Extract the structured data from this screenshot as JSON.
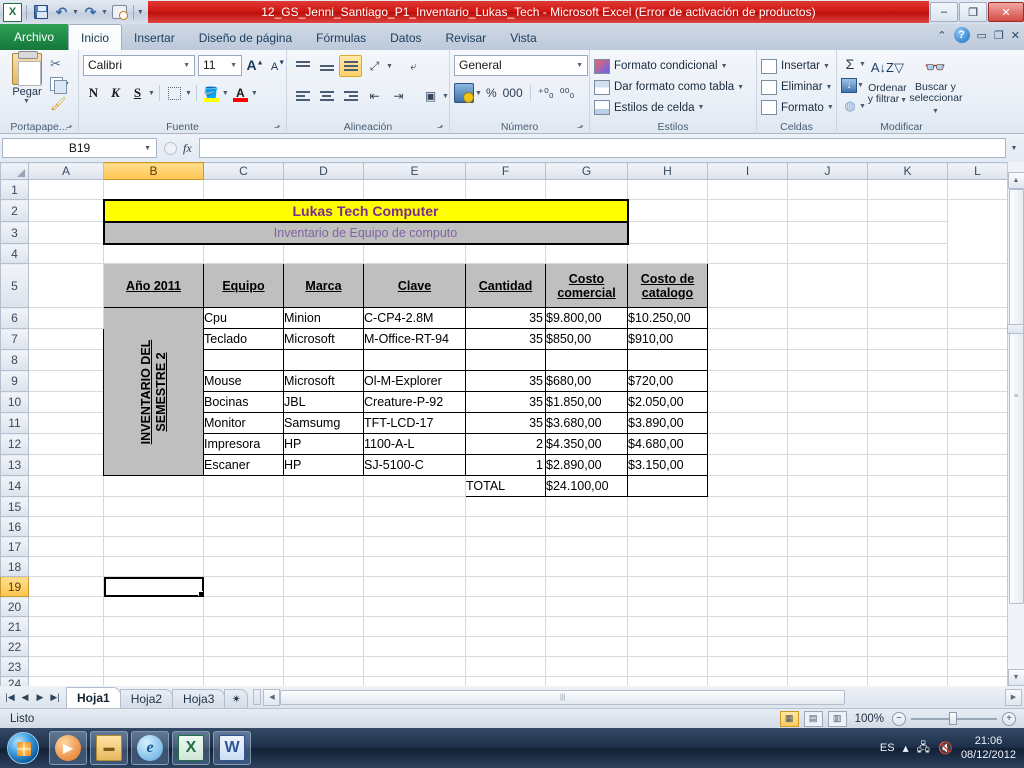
{
  "window": {
    "title": "12_GS_Jenni_Santiago_P1_Inventario_Lukas_Tech  -  Microsoft Excel (Error de activación de productos)",
    "minimize": "–",
    "restore": "❐",
    "close": "✕",
    "collapse_ribbon": "⌃",
    "help": "?"
  },
  "quick_access": {
    "app_logo": "X",
    "items": [
      {
        "name": "save-icon",
        "label": "Guardar"
      },
      {
        "name": "undo-icon",
        "label": "Deshacer"
      },
      {
        "name": "redo-icon",
        "label": "Rehacer"
      },
      {
        "name": "print-preview-icon",
        "label": "Vista preliminar"
      },
      {
        "name": "customize-qat-icon",
        "label": "Personalizar"
      }
    ]
  },
  "ribbon": {
    "tabs": [
      {
        "label": "Archivo",
        "active": false,
        "file": true
      },
      {
        "label": "Inicio",
        "active": true
      },
      {
        "label": "Insertar",
        "active": false
      },
      {
        "label": "Diseño de página",
        "active": false
      },
      {
        "label": "Fórmulas",
        "active": false
      },
      {
        "label": "Datos",
        "active": false
      },
      {
        "label": "Revisar",
        "active": false
      },
      {
        "label": "Vista",
        "active": false
      }
    ],
    "groups": {
      "clipboard": {
        "label": "Portapape...",
        "paste": "Pegar",
        "cut": "Cortar",
        "copy": "Copiar",
        "format_painter": "Copiar formato"
      },
      "font": {
        "label": "Fuente",
        "font_name": "Calibri",
        "font_size": "11",
        "grow": "A",
        "shrink": "A",
        "bold": "N",
        "italic": "K",
        "underline": "S",
        "borders": "Bordes",
        "fill_color": "Color de relleno",
        "fill_color_value": "#ffff00",
        "font_color": "A",
        "font_color_value": "#ff0000"
      },
      "alignment": {
        "label": "Alineación",
        "align_top": "Alinear en la parte superior",
        "align_middle": "Alinear en el medio",
        "align_bottom": "Alinear en la parte inferior",
        "orientation": "Orientación",
        "align_left": "Alinear texto a la izquierda",
        "align_center": "Centrar",
        "align_right": "Alinear texto a la derecha",
        "decrease_indent": "Disminuir sangría",
        "increase_indent": "Aumentar sangría",
        "wrap_text": "Ajustar texto",
        "merge": "Combinar y centrar"
      },
      "number": {
        "label": "Número",
        "format": "General",
        "currency": "Formato de número de contabilidad",
        "percent": "%",
        "comma": "000",
        "increase_decimal": "Aumentar decimales",
        "decrease_decimal": "Disminuir decimales"
      },
      "styles": {
        "label": "Estilos",
        "items": [
          {
            "label": "Formato condicional",
            "icon": "conditional-format-icon"
          },
          {
            "label": "Dar formato como tabla",
            "icon": "format-as-table-icon"
          },
          {
            "label": "Estilos de celda",
            "icon": "cell-styles-icon"
          }
        ]
      },
      "cells": {
        "label": "Celdas",
        "items": [
          {
            "label": "Insertar",
            "icon": "insert-cells-icon"
          },
          {
            "label": "Eliminar",
            "icon": "delete-cells-icon"
          },
          {
            "label": "Formato",
            "icon": "format-cells-icon"
          }
        ]
      },
      "editing": {
        "label": "Modificar",
        "autosum": "Σ",
        "fill": "Rellenar",
        "clear": "Borrar",
        "sort_filter_line1": "Ordenar",
        "sort_filter_line2": "y filtrar",
        "find_select_line1": "Buscar y",
        "find_select_line2": "seleccionar"
      }
    }
  },
  "formula_bar": {
    "name_box": "B19",
    "fx_label": "fx",
    "value": ""
  },
  "grid": {
    "columns": [
      "A",
      "B",
      "C",
      "D",
      "E",
      "F",
      "G",
      "H",
      "I",
      "J",
      "K",
      "L"
    ],
    "selected_column": "B",
    "selected_row": "19",
    "selected_cell": "B19",
    "rows": [
      "1",
      "2",
      "3",
      "4",
      "5",
      "6",
      "7",
      "8",
      "9",
      "10",
      "11",
      "12",
      "13",
      "14",
      "15",
      "16",
      "17",
      "18",
      "19",
      "20",
      "21",
      "22",
      "23",
      "24"
    ]
  },
  "report": {
    "title": "Lukas Tech Computer",
    "subtitle": "Inventario de Equipo de computo",
    "vertical_label_line1": "INVENTARIO DEL",
    "vertical_label_line2": "SEMESTRE 2",
    "headers": {
      "year": "Año 2011",
      "equipo": "Equipo",
      "marca": "Marca",
      "clave": "Clave",
      "cantidad": "Cantidad",
      "costo_comercial_line1": "Costo ",
      "costo_comercial_line2": "comercial",
      "costo_catalogo_line1": "Costo de ",
      "costo_catalogo_line2": "catalogo"
    },
    "rows": [
      {
        "equipo": "Cpu",
        "marca": "Minion",
        "clave": "C-CP4-2.8M",
        "cantidad": "35",
        "costo_comercial": "$9.800,00",
        "costo_catalogo": "$10.250,00"
      },
      {
        "equipo": "Teclado",
        "marca": "Microsoft",
        "clave": "M-Office-RT-94",
        "cantidad": "35",
        "costo_comercial": "$850,00",
        "costo_catalogo": "$910,00"
      },
      {
        "equipo": "",
        "marca": "",
        "clave": "",
        "cantidad": "",
        "costo_comercial": "",
        "costo_catalogo": ""
      },
      {
        "equipo": "Mouse",
        "marca": "Microsoft",
        "clave": "Ol-M-Explorer",
        "cantidad": "35",
        "costo_comercial": "$680,00",
        "costo_catalogo": "$720,00"
      },
      {
        "equipo": "Bocinas",
        "marca": "JBL",
        "clave": "Creature-P-92",
        "cantidad": "35",
        "costo_comercial": "$1.850,00",
        "costo_catalogo": "$2.050,00"
      },
      {
        "equipo": "Monitor",
        "marca": "Samsumg",
        "clave": "TFT-LCD-17",
        "cantidad": "35",
        "costo_comercial": "$3.680,00",
        "costo_catalogo": "$3.890,00"
      },
      {
        "equipo": "Impresora",
        "marca": "HP",
        "clave": "1100-A-L",
        "cantidad": "2",
        "costo_comercial": "$4.350,00",
        "costo_catalogo": "$4.680,00"
      },
      {
        "equipo": "Escaner",
        "marca": "HP",
        "clave": "SJ-5100-C",
        "cantidad": "1",
        "costo_comercial": "$2.890,00",
        "costo_catalogo": "$3.150,00"
      }
    ],
    "total_label": "TOTAL",
    "total_value": "$24.100,00",
    "colors": {
      "title_fill": "#ffff00",
      "title_text": "#7b2d8e",
      "subtitle_fill": "#bfbfbf",
      "subtitle_text": "#8064a2",
      "header_fill": "#bfbfbf"
    }
  },
  "sheet_tabs": {
    "nav_first": "|◀",
    "nav_prev": "◀",
    "nav_next": "▶",
    "nav_last": "▶|",
    "tabs": [
      {
        "label": "Hoja1",
        "active": true
      },
      {
        "label": "Hoja2",
        "active": false
      },
      {
        "label": "Hoja3",
        "active": false
      }
    ],
    "new_sheet": "✴"
  },
  "status_bar": {
    "status": "Listo",
    "views": [
      {
        "name": "normal-view-button",
        "glyph": "▦",
        "selected": true
      },
      {
        "name": "page-layout-view-button",
        "glyph": "▤",
        "selected": false
      },
      {
        "name": "page-break-view-button",
        "glyph": "▥",
        "selected": false
      }
    ],
    "zoom": "100%",
    "zoom_out": "−",
    "zoom_in": "+"
  },
  "taskbar": {
    "start": "Inicio",
    "items": [
      {
        "name": "taskbar-media-player",
        "glyph": "▶",
        "cls": "wmp"
      },
      {
        "name": "taskbar-explorer",
        "glyph": "▬",
        "cls": "folder"
      },
      {
        "name": "taskbar-internet-explorer",
        "glyph": "e",
        "cls": "ie"
      },
      {
        "name": "taskbar-excel",
        "glyph": "X",
        "cls": "xl"
      },
      {
        "name": "taskbar-word",
        "glyph": "W",
        "cls": "wd"
      }
    ],
    "language": "ES",
    "time": "21:06",
    "date": "08/12/2012"
  }
}
